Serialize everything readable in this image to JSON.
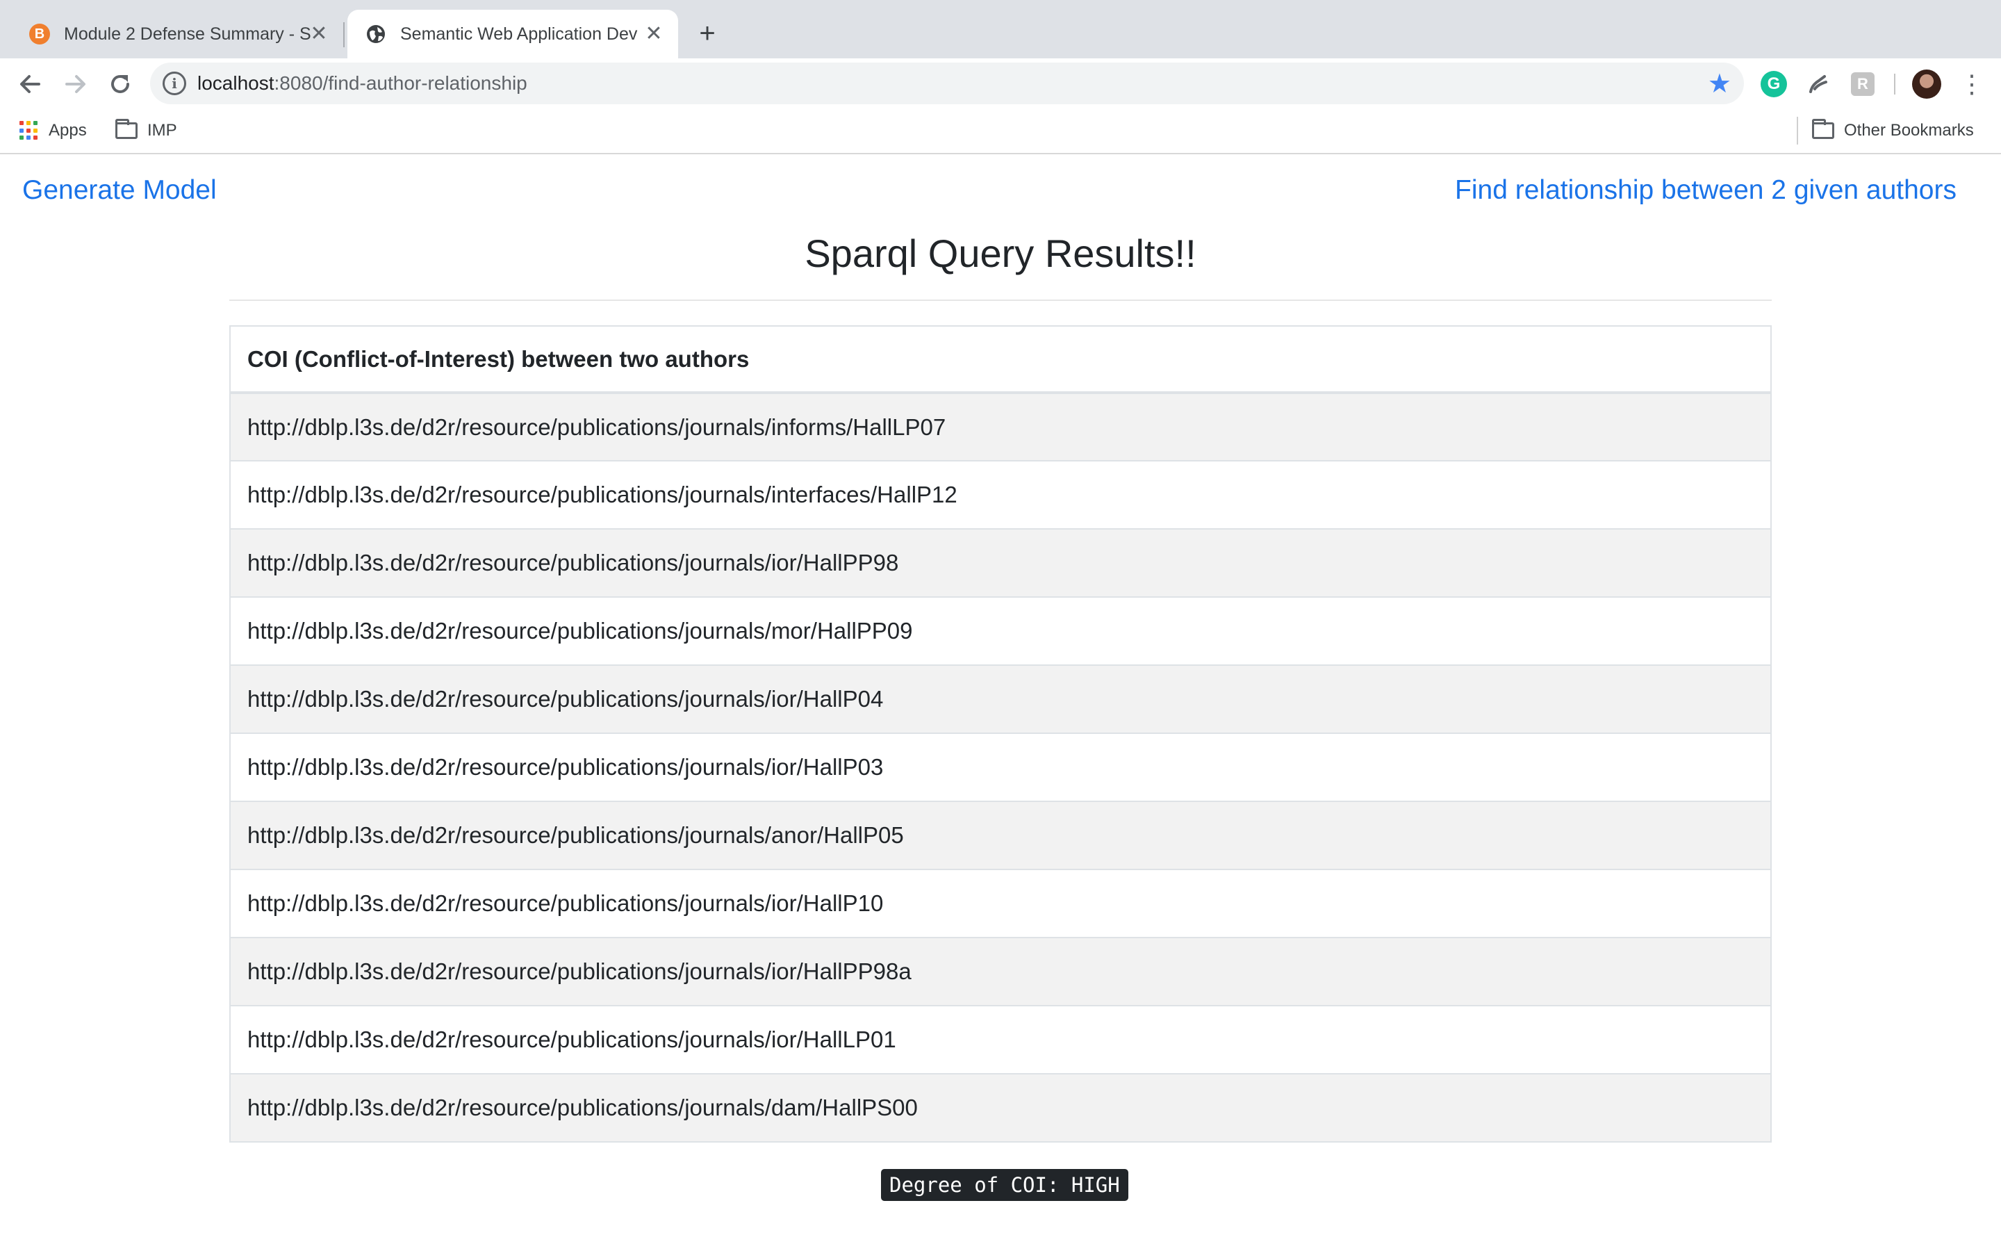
{
  "browser": {
    "tabs": [
      {
        "title": "Module 2 Defense Summary - S",
        "favicon": "brave-favicon-icon",
        "active": false
      },
      {
        "title": "Semantic Web Application Dev",
        "favicon": "globe-icon",
        "active": true
      }
    ],
    "new_tab_symbol": "+",
    "close_symbol": "✕",
    "url_host": "localhost",
    "url_path": ":8080/find-author-relationship",
    "bookmarks": {
      "apps": "Apps",
      "imp": "IMP",
      "other": "Other Bookmarks"
    },
    "colors": {
      "tabstrip": "#dee1e6",
      "bookmark_star": "#4285f4",
      "grammarly": "#15c39a"
    }
  },
  "page": {
    "nav": {
      "generate_model": "Generate Model",
      "find_relationship": "Find relationship between 2 given authors"
    },
    "title": "Sparql Query Results!!",
    "table": {
      "header": "COI (Conflict-of-Interest) between two authors",
      "rows": [
        "http://dblp.l3s.de/d2r/resource/publications/journals/informs/HallLP07",
        "http://dblp.l3s.de/d2r/resource/publications/journals/interfaces/HallP12",
        "http://dblp.l3s.de/d2r/resource/publications/journals/ior/HallPP98",
        "http://dblp.l3s.de/d2r/resource/publications/journals/mor/HallPP09",
        "http://dblp.l3s.de/d2r/resource/publications/journals/ior/HallP04",
        "http://dblp.l3s.de/d2r/resource/publications/journals/ior/HallP03",
        "http://dblp.l3s.de/d2r/resource/publications/journals/anor/HallP05",
        "http://dblp.l3s.de/d2r/resource/publications/journals/ior/HallP10",
        "http://dblp.l3s.de/d2r/resource/publications/journals/ior/HallPP98a",
        "http://dblp.l3s.de/d2r/resource/publications/journals/ior/HallLP01",
        "http://dblp.l3s.de/d2r/resource/publications/journals/dam/HallPS00"
      ]
    },
    "coi_degree": "Degree of COI: HIGH",
    "colors": {
      "link": "#1a73e8",
      "stripe": "#f2f2f2",
      "badge_bg": "#212529"
    }
  }
}
